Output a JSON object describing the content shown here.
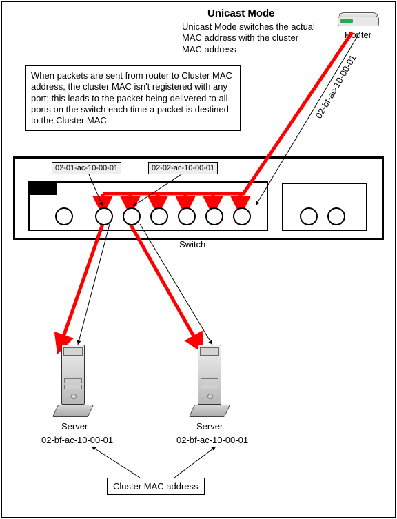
{
  "title": "Unicast Mode",
  "subtitle": "Unicast Mode switches the actual MAC address with the cluster MAC address",
  "router_label": "Router",
  "callout_text": "When packets are sent from router to Cluster MAC address, the cluster MAC isn't registered with any port; this leads to the packet being delivered to all ports on the switch each time a packet is destined to the Cluster MAC",
  "switch_label": "Switch",
  "port_tag_1": "02-01-ac-10-00-01",
  "port_tag_2": "02-02-ac-10-00-01",
  "incoming_mac": "02-bf-ac-10-00-01",
  "server1": {
    "label": "Server",
    "mac": "02-bf-ac-10-00-01"
  },
  "server2": {
    "label": "Server",
    "mac": "02-bf-ac-10-00-01"
  },
  "cluster_label": "Cluster MAC address"
}
